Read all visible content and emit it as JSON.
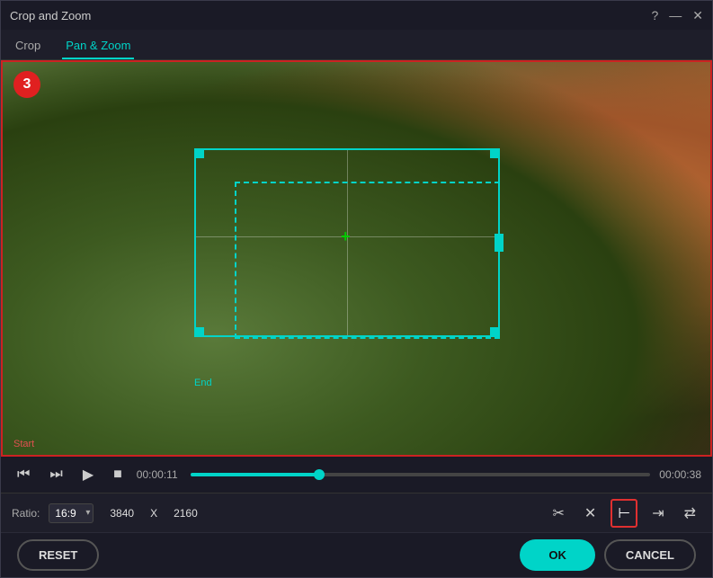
{
  "window": {
    "title": "Crop and Zoom"
  },
  "tabs": [
    {
      "id": "crop",
      "label": "Crop",
      "active": false
    },
    {
      "id": "pan-zoom",
      "label": "Pan & Zoom",
      "active": true
    }
  ],
  "video": {
    "frame_number": "3",
    "start_label": "Start",
    "end_label": "End",
    "current_time": "00:00:11",
    "total_time": "00:00:38"
  },
  "controls": {
    "ratio_label": "Ratio:",
    "ratio_value": "16:9",
    "width": "3840",
    "x_label": "X",
    "height": "2160"
  },
  "buttons": {
    "reset": "RESET",
    "ok": "OK",
    "cancel": "CANCEL"
  },
  "icons": {
    "help": "?",
    "minimize": "—",
    "close": "✕",
    "skip_back": "⏮",
    "play": "▶",
    "stop": "■",
    "scissors": "✂",
    "close_x": "✕",
    "align_left": "⊢",
    "arrow_right": "→",
    "swap": "⇄"
  }
}
